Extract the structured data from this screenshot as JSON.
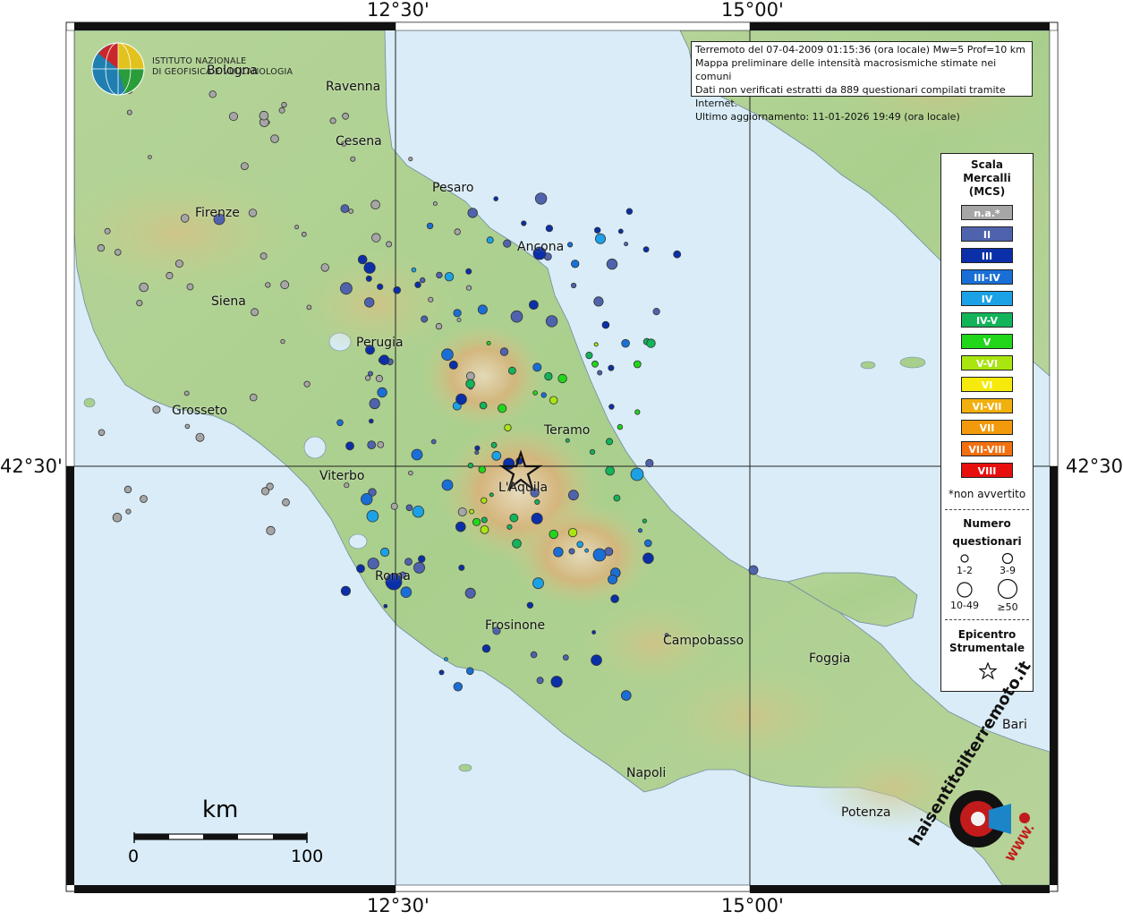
{
  "coords": {
    "top": [
      "12°30'",
      "15°00'"
    ],
    "bottom": [
      "12°30'",
      "15°00'"
    ],
    "left": "42°30'",
    "right": "42°30'"
  },
  "institute": {
    "line1": "ISTITUTO NAZIONALE",
    "line2": "DI GEOFISICA E VULCANOLOGIA"
  },
  "info": {
    "line1": "Terremoto del 07-04-2009 01:15:36 (ora locale) Mw=5 Prof=10 km",
    "line2": "Mappa preliminare delle intensità macrosismiche stimate nei comuni",
    "line3": "Dati non verificati estratti da 889 questionari compilati tramite Internet.",
    "line4": "Ultimo aggiornamento: 11-01-2026 19:49 (ora locale)"
  },
  "cities": [
    {
      "name": "Bologna"
    },
    {
      "name": "Ravenna"
    },
    {
      "name": "Cesena"
    },
    {
      "name": "Pesaro"
    },
    {
      "name": "Firenze"
    },
    {
      "name": "Ancona"
    },
    {
      "name": "Siena"
    },
    {
      "name": "Perugia"
    },
    {
      "name": "Grosseto"
    },
    {
      "name": "Teramo"
    },
    {
      "name": "Viterbo"
    },
    {
      "name": "L'Aquila"
    },
    {
      "name": "Roma"
    },
    {
      "name": "Frosinone"
    },
    {
      "name": "Campobasso"
    },
    {
      "name": "Foggia"
    },
    {
      "name": "Bari"
    },
    {
      "name": "Napoli"
    },
    {
      "name": "Potenza"
    }
  ],
  "legend": {
    "scale_title1": "Scala",
    "scale_title2": "Mercalli",
    "scale_title3": "(MCS)",
    "levels": [
      {
        "label": "n.a.*",
        "color": "#a6a6a6"
      },
      {
        "label": "II",
        "color": "#4f63ad"
      },
      {
        "label": "III",
        "color": "#0a2fa8"
      },
      {
        "label": "III-IV",
        "color": "#1a6fd6"
      },
      {
        "label": "IV",
        "color": "#1ba2e6"
      },
      {
        "label": "IV-V",
        "color": "#12b45a"
      },
      {
        "label": "V",
        "color": "#22d61a"
      },
      {
        "label": "V-VI",
        "color": "#a9e50f"
      },
      {
        "label": "VI",
        "color": "#f5ea0c"
      },
      {
        "label": "VI-VII",
        "color": "#f2b00f"
      },
      {
        "label": "VII",
        "color": "#f29a0c"
      },
      {
        "label": "VII-VIII",
        "color": "#f2700f"
      },
      {
        "label": "VIII",
        "color": "#e80f0f"
      }
    ],
    "note": "*non avvertito",
    "count_title1": "Numero",
    "count_title2": "questionari",
    "sizes": [
      "1-2",
      "3-9",
      "10-49",
      "≥50"
    ],
    "epi_title1": "Epicentro",
    "epi_title2": "Strumentale"
  },
  "scale_bar": {
    "unit": "km",
    "start": "0",
    "end": "100"
  },
  "brand": {
    "text": "haisentitoilterremoto.it",
    "url_text": "WWW."
  },
  "colors": {
    "sea": "#d9ecf7",
    "land_low": "#a8cf8e",
    "land_mid": "#c9d79a",
    "land_high": "#d9b27a"
  }
}
